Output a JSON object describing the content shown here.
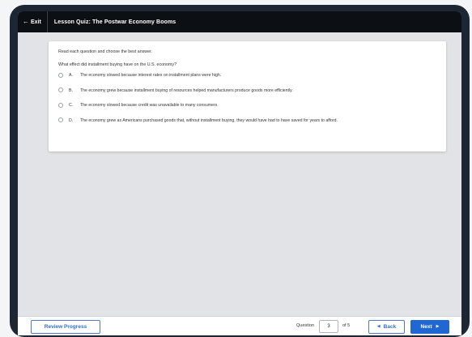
{
  "topbar": {
    "exit_label": "Exit",
    "exit_icon": "arrow-left-icon",
    "quiz_title": "Lesson Quiz: The Postwar Economy Booms"
  },
  "quiz": {
    "instructions": "Read each question and choose the best answer.",
    "question": "What effect did installment buying have on the U.S. economy?",
    "options": [
      {
        "letter": "A.",
        "text": "The economy slowed because interest rates on installment plans were high."
      },
      {
        "letter": "B.",
        "text": "The economy grew because installment buying of resources helped manufacturers produce goods more efficiently."
      },
      {
        "letter": "C.",
        "text": "The economy slowed because credit was unavailable to many consumers."
      },
      {
        "letter": "D.",
        "text": "The economy grew as Americans purchased goods that, without installment buying, they would have had to have saved for years to afford."
      }
    ]
  },
  "footer": {
    "review_label": "Review Progress",
    "question_label": "Question",
    "current_question": "3",
    "of_label": "of 5",
    "back_label": "Back",
    "next_label": "Next"
  },
  "colors": {
    "accent": "#1f67d2",
    "topbar": "#0c0f14",
    "frame": "#1c2733"
  }
}
